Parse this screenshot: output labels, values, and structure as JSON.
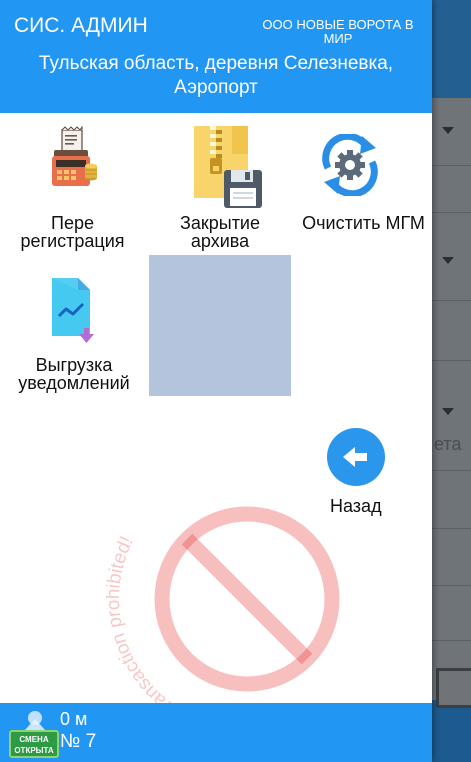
{
  "header": {
    "role": "СИС. АДМИН",
    "org": "ООО НОВЫЕ ВОРОТА В МИР",
    "address": "Тульская область, деревня Селезневка, Аэропорт"
  },
  "menu": {
    "reregistration": "Пере регистрация",
    "close_archive": "Закрытие архива",
    "clear_mgm": "Очистить МГМ",
    "export_notifications": "Выгрузка уведомлений",
    "back": "Назад"
  },
  "watermark": "Debug mode, transaction prohibited!",
  "background": {
    "partial_text": "ета"
  },
  "footer": {
    "distance": "0 м",
    "shift_badge": "СМЕНА ОТКРЫТА",
    "shift_number": "№ 7"
  },
  "colors": {
    "primary": "#2196f3",
    "shift_open": "#2e9a43",
    "watermark": "#e53935"
  }
}
